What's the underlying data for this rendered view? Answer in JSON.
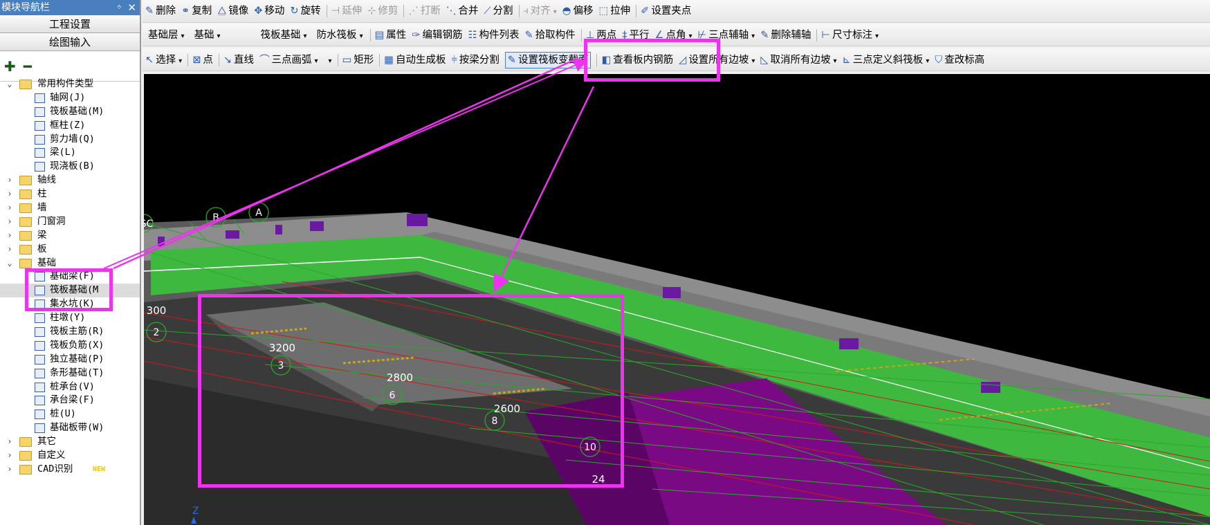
{
  "nav": {
    "title": "模块导航栏",
    "pin_glyph": "ᛜ",
    "close_glyph": "✕",
    "buttons": [
      "工程设置",
      "绘图输入"
    ],
    "tools": [
      "✚",
      "━"
    ],
    "tree": [
      {
        "label": "常用构件类型",
        "level": 0,
        "toggle": "⌄",
        "icon": "folder-open",
        "expanded": true
      },
      {
        "label": "轴网(J)",
        "level": 1,
        "icon": "axis-grid-icon"
      },
      {
        "label": "筏板基础(M)",
        "level": 1,
        "icon": "raft-foundation-icon"
      },
      {
        "label": "框柱(Z)",
        "level": 1,
        "icon": "frame-column-icon"
      },
      {
        "label": "剪力墙(Q)",
        "level": 1,
        "icon": "shear-wall-icon"
      },
      {
        "label": "梁(L)",
        "level": 1,
        "icon": "beam-icon"
      },
      {
        "label": "现浇板(B)",
        "level": 1,
        "icon": "cast-slab-icon"
      },
      {
        "label": "轴线",
        "level": 0,
        "toggle": "›",
        "icon": "folder"
      },
      {
        "label": "柱",
        "level": 0,
        "toggle": "›",
        "icon": "folder"
      },
      {
        "label": "墙",
        "level": 0,
        "toggle": "›",
        "icon": "folder"
      },
      {
        "label": "门窗洞",
        "level": 0,
        "toggle": "›",
        "icon": "folder"
      },
      {
        "label": "梁",
        "level": 0,
        "toggle": "›",
        "icon": "folder"
      },
      {
        "label": "板",
        "level": 0,
        "toggle": "›",
        "icon": "folder"
      },
      {
        "label": "基础",
        "level": 0,
        "toggle": "⌄",
        "icon": "folder-open",
        "expanded": true
      },
      {
        "label": "基础梁(F)",
        "level": 1,
        "icon": "foundation-beam-icon"
      },
      {
        "label": "筏板基础(M",
        "level": 1,
        "icon": "raft-foundation-icon",
        "selected": true
      },
      {
        "label": "集水坑(K)",
        "level": 1,
        "icon": "sump-pit-icon"
      },
      {
        "label": "柱墩(Y)",
        "level": 1,
        "icon": "column-pier-icon"
      },
      {
        "label": "筏板主筋(R)",
        "level": 1,
        "icon": "raft-main-rebar-icon"
      },
      {
        "label": "筏板负筋(X)",
        "level": 1,
        "icon": "raft-negative-rebar-icon"
      },
      {
        "label": "独立基础(P)",
        "level": 1,
        "icon": "isolated-footing-icon"
      },
      {
        "label": "条形基础(T)",
        "level": 1,
        "icon": "strip-footing-icon"
      },
      {
        "label": "桩承台(V)",
        "level": 1,
        "icon": "pile-cap-icon"
      },
      {
        "label": "承台梁(F)",
        "level": 1,
        "icon": "cap-beam-icon"
      },
      {
        "label": "桩(U)",
        "level": 1,
        "icon": "pile-icon"
      },
      {
        "label": "基础板带(W)",
        "level": 1,
        "icon": "foundation-strip-icon"
      },
      {
        "label": "其它",
        "level": 0,
        "toggle": "›",
        "icon": "folder"
      },
      {
        "label": "自定义",
        "level": 0,
        "toggle": "›",
        "icon": "folder"
      },
      {
        "label": "CAD识别",
        "level": 0,
        "toggle": "›",
        "icon": "folder",
        "badge": "NEW"
      }
    ]
  },
  "toolbar1": [
    {
      "label": "删除",
      "icon": "delete-icon",
      "glyph": "✎"
    },
    {
      "label": "复制",
      "icon": "copy-icon",
      "glyph": "⚭"
    },
    {
      "label": "镜像",
      "icon": "mirror-icon",
      "glyph": "⧋"
    },
    {
      "label": "移动",
      "icon": "move-icon",
      "glyph": "✥"
    },
    {
      "label": "旋转",
      "icon": "rotate-icon",
      "glyph": "↻"
    },
    {
      "label": "延伸",
      "icon": "extend-icon",
      "glyph": "⊣",
      "disabled": true
    },
    {
      "label": "修剪",
      "icon": "trim-icon",
      "glyph": "⊹",
      "disabled": true
    },
    {
      "label": "打断",
      "icon": "break-icon",
      "glyph": "⋰",
      "disabled": true
    },
    {
      "label": "合并",
      "icon": "merge-icon",
      "glyph": "⋱"
    },
    {
      "label": "分割",
      "icon": "split-icon",
      "glyph": "⟋"
    },
    {
      "label": "对齐",
      "icon": "align-icon",
      "glyph": "⫞",
      "disabled": true,
      "caret": true
    },
    {
      "label": "偏移",
      "icon": "offset-icon",
      "glyph": "◓"
    },
    {
      "label": "拉伸",
      "icon": "stretch-icon",
      "glyph": "⬚"
    },
    {
      "label": "设置夹点",
      "icon": "grip-icon",
      "glyph": "✐"
    }
  ],
  "toolbar2": {
    "dropdowns": [
      {
        "value": "基础层",
        "name": "floor-select"
      },
      {
        "value": "基础",
        "name": "category-select"
      },
      {
        "value": "筏板基础",
        "name": "component-type-select"
      },
      {
        "value": "防水筏板",
        "name": "component-name-select"
      }
    ],
    "items": [
      {
        "label": "属性",
        "icon": "properties-icon",
        "glyph": "▤"
      },
      {
        "label": "编辑钢筋",
        "icon": "edit-rebar-icon",
        "glyph": "✑"
      },
      {
        "label": "构件列表",
        "icon": "component-list-icon",
        "glyph": "☷"
      },
      {
        "label": "拾取构件",
        "icon": "pick-component-icon",
        "glyph": "✎"
      },
      {
        "label": "两点",
        "icon": "two-point-icon",
        "glyph": "⊥"
      },
      {
        "label": "平行",
        "icon": "parallel-icon",
        "glyph": "‡"
      },
      {
        "label": "点角",
        "icon": "point-angle-icon",
        "glyph": "∠",
        "caret": true
      },
      {
        "label": "三点辅轴",
        "icon": "three-point-axis-icon",
        "glyph": "⊬",
        "caret": true
      },
      {
        "label": "删除辅轴",
        "icon": "delete-axis-icon",
        "glyph": "✎"
      },
      {
        "label": "尺寸标注",
        "icon": "dimension-icon",
        "glyph": "⊢",
        "caret": true
      }
    ]
  },
  "toolbar3": [
    {
      "label": "选择",
      "icon": "select-icon",
      "glyph": "↖",
      "caret": true
    },
    {
      "label": "点",
      "icon": "point-icon",
      "glyph": "⊠"
    },
    {
      "label": "直线",
      "icon": "line-icon",
      "glyph": "↘"
    },
    {
      "label": "三点画弧",
      "icon": "arc-icon",
      "glyph": "⌒",
      "caret": true
    },
    {
      "label": "",
      "icon": "blank-dropdown",
      "glyph": "",
      "caret": true
    },
    {
      "label": "矩形",
      "icon": "rectangle-icon",
      "glyph": "▭"
    },
    {
      "label": "自动生成板",
      "icon": "auto-slab-icon",
      "glyph": "▦"
    },
    {
      "label": "按梁分割",
      "icon": "split-by-beam-icon",
      "glyph": "⫩"
    },
    {
      "label": "设置筏板变截面",
      "icon": "raft-variable-section-icon",
      "glyph": "✎",
      "highlighted": true
    },
    {
      "label": "查看板内钢筋",
      "icon": "view-rebar-icon",
      "glyph": "◧"
    },
    {
      "label": "设置所有边坡",
      "icon": "set-slopes-icon",
      "glyph": "◿",
      "caret": true
    },
    {
      "label": "取消所有边坡",
      "icon": "cancel-slopes-icon",
      "glyph": "◺",
      "caret": true
    },
    {
      "label": "三点定义斜筏板",
      "icon": "three-point-slope-icon",
      "glyph": "⊾",
      "caret": true
    },
    {
      "label": "查改标高",
      "icon": "elevation-icon",
      "glyph": "⛉"
    }
  ],
  "viewport": {
    "axis_labels": [
      "SC",
      "B",
      "A",
      "2",
      "3",
      "6",
      "8",
      "10"
    ],
    "dimension_labels": [
      "300",
      "3200",
      "2800",
      "2600",
      "24"
    ],
    "z_label": "Z",
    "colors": {
      "slab_green": "#3fb83f",
      "gray": "#8a8a8a",
      "purple": "#7a0a84",
      "highlight": "#ee33ee",
      "axis_green": "#2aa82a"
    }
  }
}
